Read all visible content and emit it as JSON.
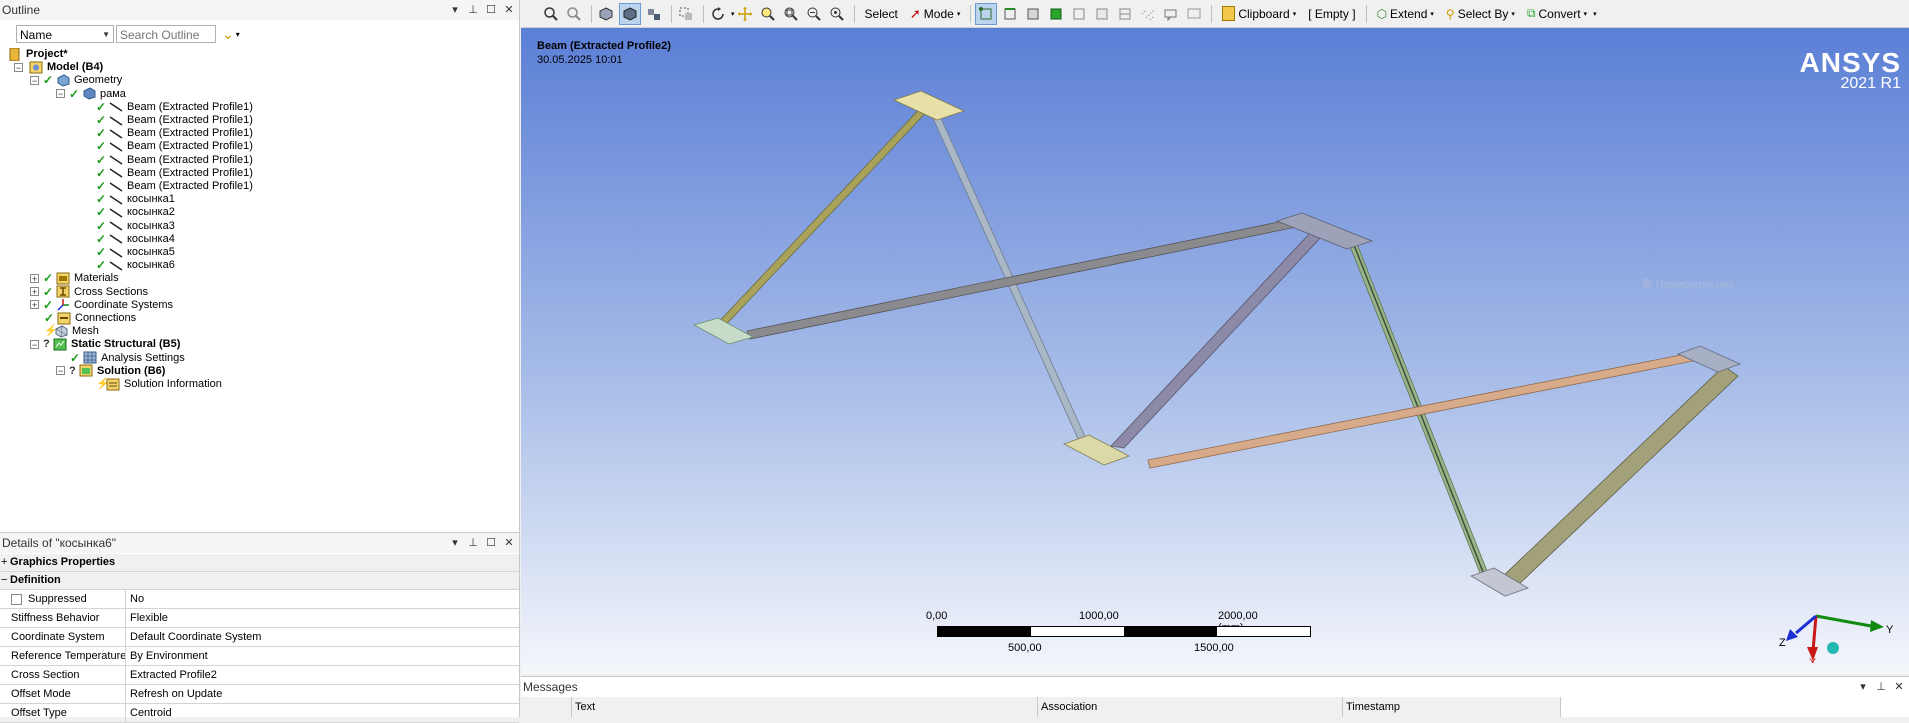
{
  "outline": {
    "title": "Outline",
    "filter_combo": "Name",
    "search_placeholder": "Search Outline",
    "tree": [
      {
        "label": "Project*",
        "bold": true
      },
      {
        "label": "Model (B4)",
        "bold": true
      },
      {
        "label": "Geometry"
      },
      {
        "label": "рама"
      },
      {
        "label": "Beam (Extracted Profile1)"
      },
      {
        "label": "Beam (Extracted Profile1)"
      },
      {
        "label": "Beam (Extracted Profile1)"
      },
      {
        "label": "Beam (Extracted Profile1)"
      },
      {
        "label": "Beam (Extracted Profile1)"
      },
      {
        "label": "Beam (Extracted Profile1)"
      },
      {
        "label": "Beam (Extracted Profile1)"
      },
      {
        "label": "косынка1"
      },
      {
        "label": "косынка2"
      },
      {
        "label": "косынка3"
      },
      {
        "label": "косынка4"
      },
      {
        "label": "косынка5"
      },
      {
        "label": "косынка6"
      },
      {
        "label": "Materials"
      },
      {
        "label": "Cross Sections"
      },
      {
        "label": "Coordinate Systems"
      },
      {
        "label": "Connections"
      },
      {
        "label": "Mesh"
      },
      {
        "label": "Static Structural (B5)",
        "bold": true
      },
      {
        "label": "Analysis Settings"
      },
      {
        "label": "Solution (B6)",
        "bold": true
      },
      {
        "label": "Solution Information"
      }
    ]
  },
  "details": {
    "title": "Details of \"косынка6\"",
    "sections": {
      "graphics": "Graphics Properties",
      "definition": "Definition"
    },
    "rows": [
      {
        "key": "Suppressed",
        "value": "No"
      },
      {
        "key": "Stiffness Behavior",
        "value": "Flexible"
      },
      {
        "key": "Coordinate System",
        "value": "Default Coordinate System"
      },
      {
        "key": "Reference Temperature",
        "value": "By Environment"
      },
      {
        "key": "Cross Section",
        "value": "Extracted Profile2"
      },
      {
        "key": "Offset Mode",
        "value": "Refresh on Update"
      },
      {
        "key": "Offset Type",
        "value": "Centroid"
      }
    ]
  },
  "toolbar": {
    "select": "Select",
    "mode": "Mode",
    "clipboard": "Clipboard",
    "empty": "[ Empty ]",
    "extend": "Extend",
    "select_by": "Select By",
    "convert": "Convert"
  },
  "viewport": {
    "title": "Beam (Extracted Profile2)",
    "date": "30.05.2025 10:01",
    "logo": "ANSYS",
    "version": "2021 R1",
    "ghost_label": "Прямоугольник",
    "scale": {
      "top_labels": [
        "0,00",
        "1000,00",
        "2000,00 (mm)"
      ],
      "bottom_labels": [
        "500,00",
        "1500,00"
      ]
    },
    "triad": {
      "x": "X",
      "y": "Y",
      "z": "Z"
    }
  },
  "messages": {
    "title": "Messages",
    "columns": [
      "Text",
      "Association",
      "Timestamp"
    ]
  },
  "colors": {
    "viewport_top": "#5b7fd6",
    "viewport_bottom": "#f4f6fb",
    "check_green": "#1a9b1a"
  }
}
